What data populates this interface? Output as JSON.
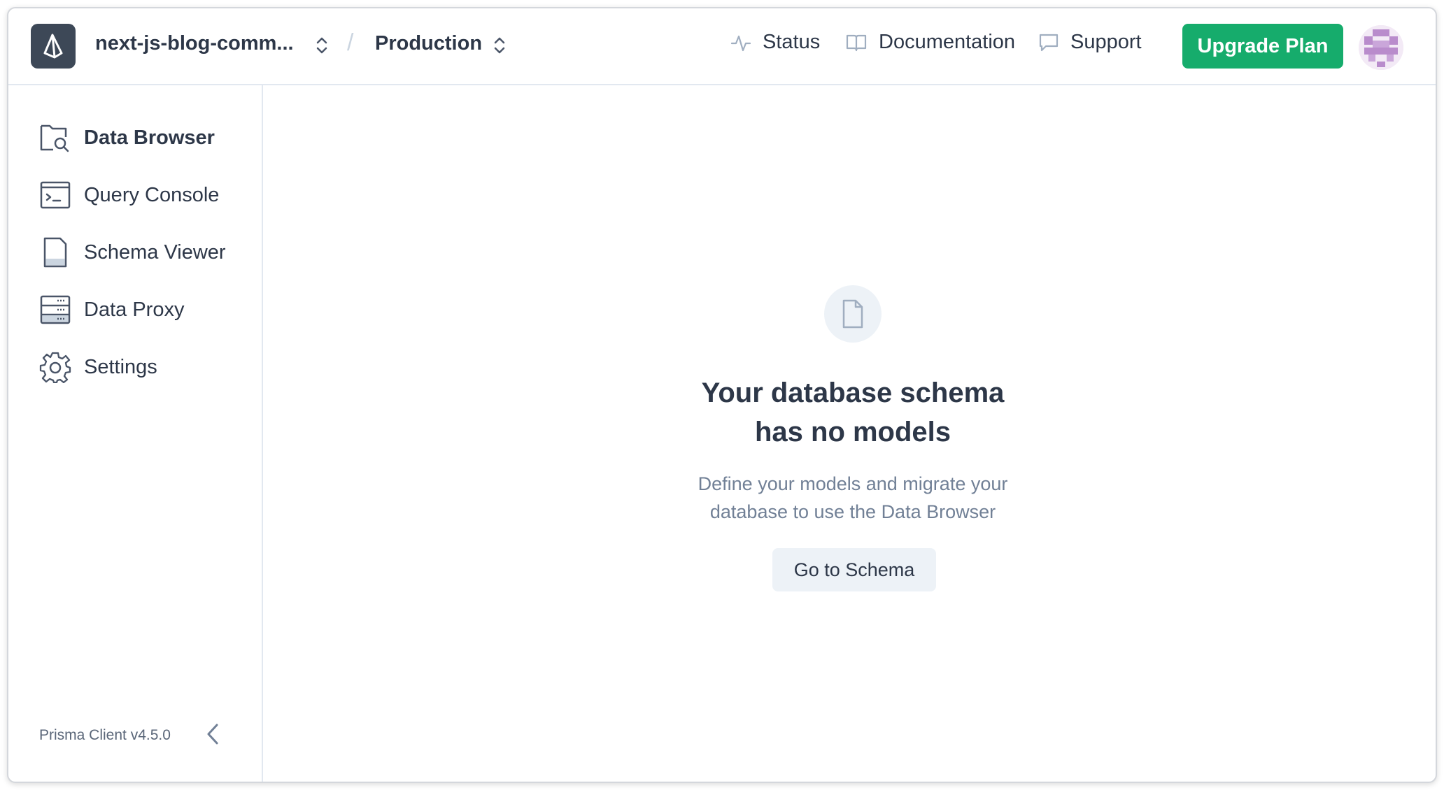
{
  "header": {
    "project_name": "next-js-blog-comm...",
    "environment": "Production",
    "links": {
      "status": "Status",
      "documentation": "Documentation",
      "support": "Support"
    },
    "upgrade_label": "Upgrade Plan"
  },
  "sidebar": {
    "items": [
      {
        "label": "Data Browser",
        "icon": "folder-search-icon",
        "active": true
      },
      {
        "label": "Query Console",
        "icon": "terminal-icon",
        "active": false
      },
      {
        "label": "Schema Viewer",
        "icon": "document-icon",
        "active": false
      },
      {
        "label": "Data Proxy",
        "icon": "server-icon",
        "active": false
      },
      {
        "label": "Settings",
        "icon": "gear-icon",
        "active": false
      }
    ],
    "client_version": "Prisma Client v4.5.0"
  },
  "main": {
    "empty_title_line1": "Your database schema",
    "empty_title_line2": "has no models",
    "empty_desc_line1": "Define your models and migrate your",
    "empty_desc_line2": "database to use the Data Browser",
    "button_label": "Go to Schema"
  },
  "colors": {
    "accent": "#16ac6c",
    "logo_bg": "#3d4857",
    "text": "#2d3748",
    "muted": "#718096"
  }
}
